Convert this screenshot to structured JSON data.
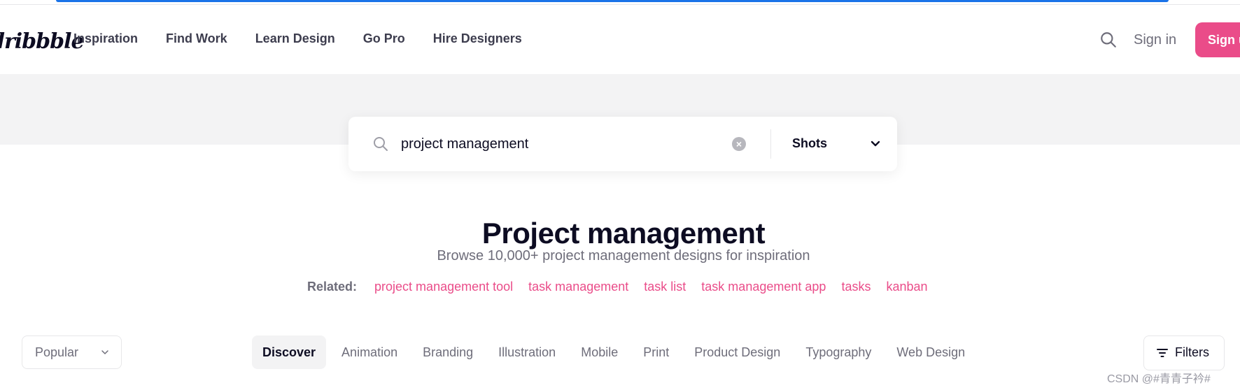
{
  "header": {
    "logo_text": "dribbble",
    "nav": [
      "Inspiration",
      "Find Work",
      "Learn Design",
      "Go Pro",
      "Hire Designers"
    ],
    "sign_in": "Sign in",
    "sign_up": "Sign up"
  },
  "search": {
    "value": "project management",
    "type_selected": "Shots"
  },
  "page": {
    "title": "Project management",
    "subtitle": "Browse 10,000+ project management designs for inspiration"
  },
  "related": {
    "label": "Related:",
    "links": [
      "project management tool",
      "task management",
      "task list",
      "task management app",
      "tasks",
      "kanban"
    ]
  },
  "filters_bar": {
    "sort": "Popular",
    "categories": [
      "Discover",
      "Animation",
      "Branding",
      "Illustration",
      "Mobile",
      "Print",
      "Product Design",
      "Typography",
      "Web Design"
    ],
    "filters_label": "Filters"
  },
  "watermark": "CSDN @#青青子衿#",
  "colors": {
    "accent_pink": "#ea4c89",
    "hero_bg": "#f3f3f4",
    "text_dark": "#0d0c22",
    "text_muted": "#6e6d7a"
  },
  "icons": {
    "search": "search-icon",
    "clear": "clear-icon",
    "dropdown": "chevron-down-icon",
    "filters": "filter-icon"
  }
}
